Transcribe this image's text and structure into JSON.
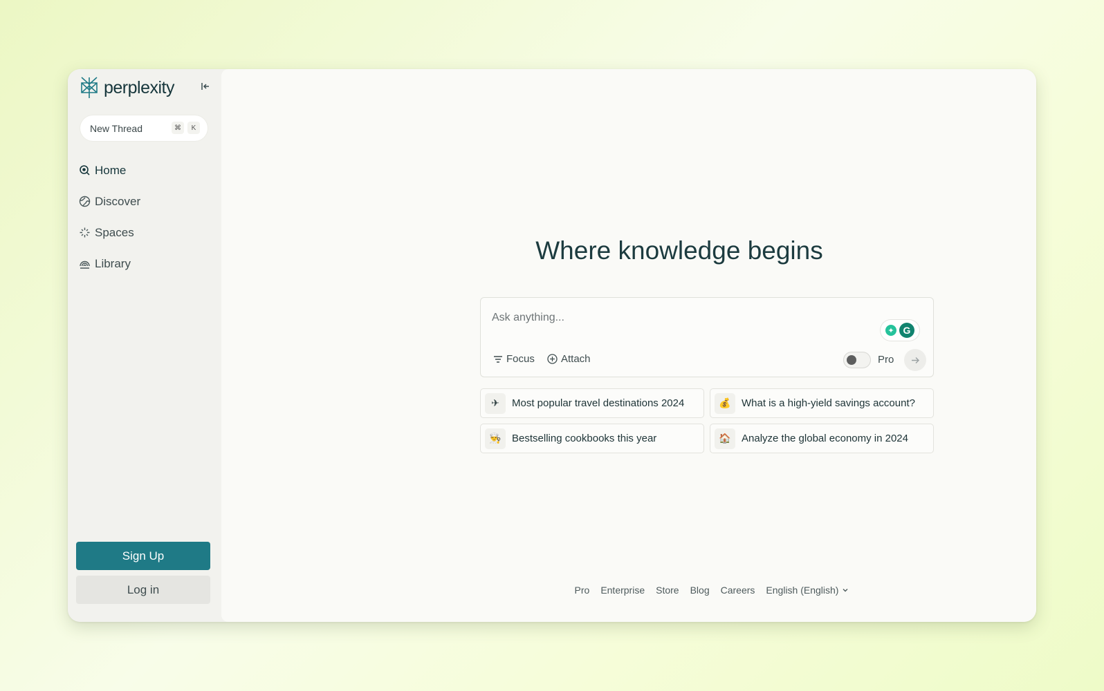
{
  "app": {
    "name": "perplexity"
  },
  "sidebar": {
    "new_thread_label": "New Thread",
    "shortcut_keys": [
      "⌘",
      "K"
    ],
    "nav_items": [
      {
        "label": "Home",
        "icon": "search-icon",
        "active": true
      },
      {
        "label": "Discover",
        "icon": "globe-icon",
        "active": false
      },
      {
        "label": "Spaces",
        "icon": "spaces-icon",
        "active": false
      },
      {
        "label": "Library",
        "icon": "library-icon",
        "active": false
      }
    ],
    "signup_label": "Sign Up",
    "login_label": "Log in"
  },
  "main": {
    "headline": "Where knowledge begins",
    "search": {
      "placeholder": "Ask anything...",
      "focus_label": "Focus",
      "attach_label": "Attach",
      "pro_label": "Pro",
      "pro_enabled": false
    },
    "suggestions": [
      {
        "icon": "✈",
        "label": "Most popular travel destinations 2024"
      },
      {
        "icon": "💰",
        "label": "What is a high-yield savings account?"
      },
      {
        "icon": "👨‍🍳",
        "label": "Bestselling cookbooks this year"
      },
      {
        "icon": "🏠",
        "label": "Analyze the global economy in 2024"
      }
    ]
  },
  "footer": {
    "links": [
      "Pro",
      "Enterprise",
      "Store",
      "Blog",
      "Careers"
    ],
    "language": "English (English)"
  },
  "colors": {
    "accent": "#1f7a86",
    "text": "#1c3b3f",
    "sidebar_bg": "#f2f2ee",
    "main_bg": "#fafaf7"
  }
}
